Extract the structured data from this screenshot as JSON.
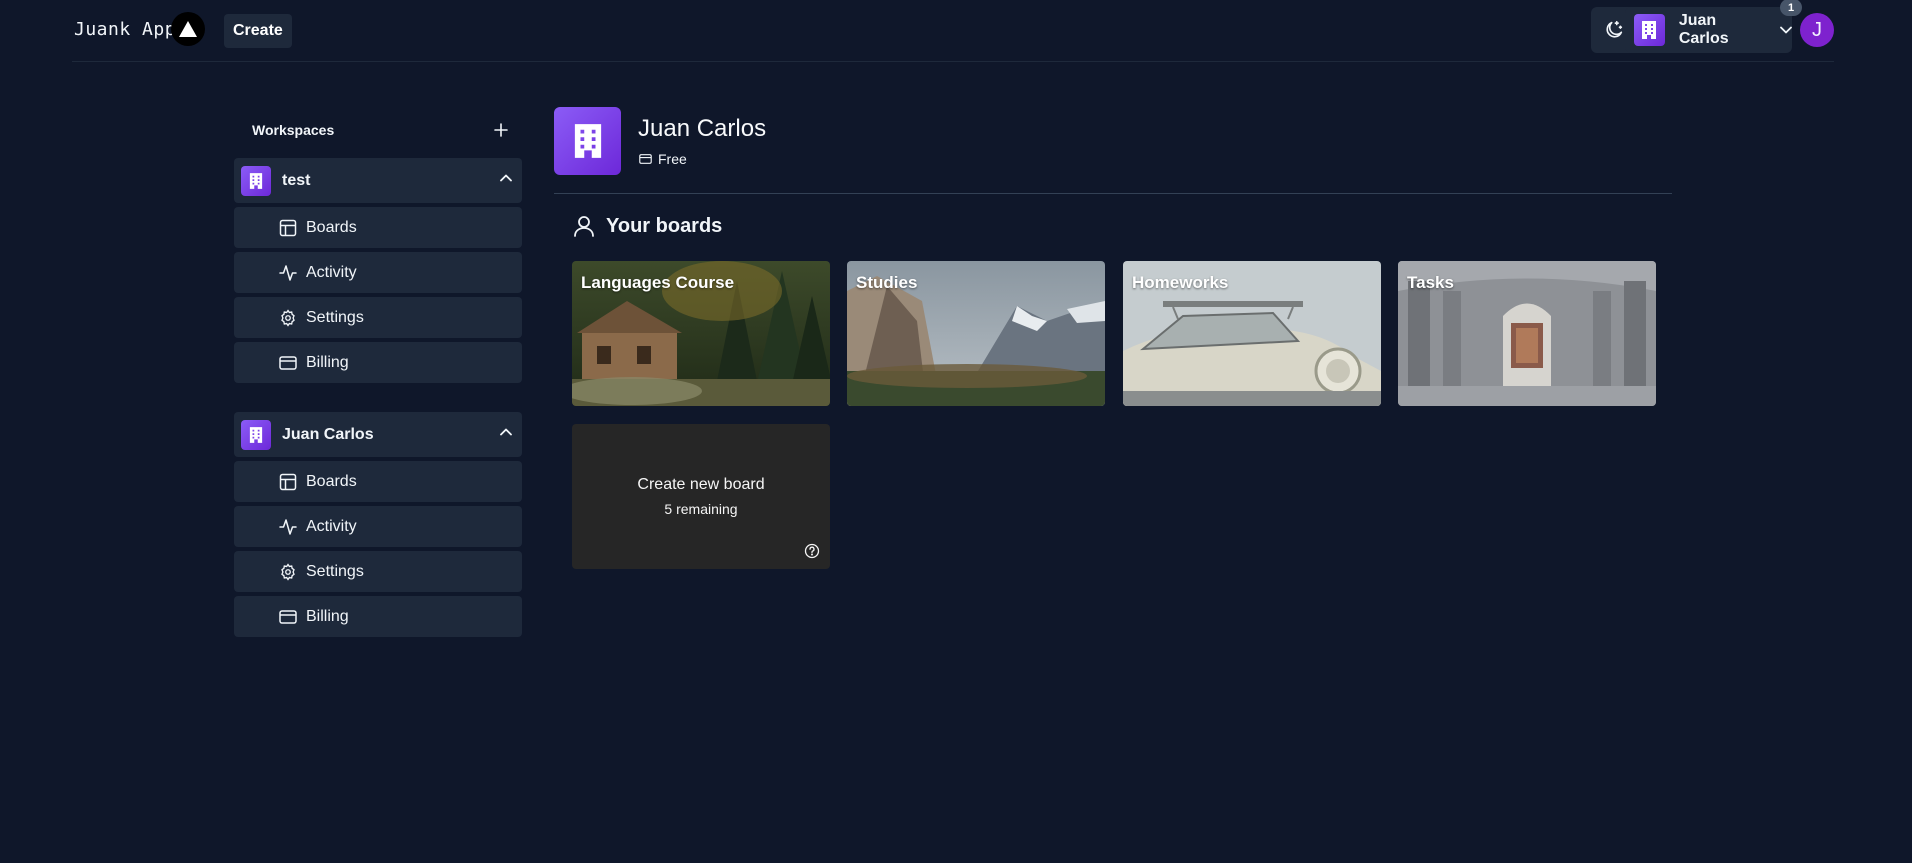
{
  "header": {
    "logo_text": "Juank App",
    "create_label": "Create",
    "workspace_name": "Juan Carlos",
    "notification_count": "1",
    "avatar_initial": "J"
  },
  "sidebar": {
    "title": "Workspaces",
    "workspaces": [
      {
        "name": "test",
        "items": [
          "Boards",
          "Activity",
          "Settings",
          "Billing"
        ]
      },
      {
        "name": "Juan Carlos",
        "items": [
          "Boards",
          "Activity",
          "Settings",
          "Billing"
        ]
      }
    ]
  },
  "main": {
    "workspace_title": "Juan Carlos",
    "plan": "Free",
    "boards_heading": "Your boards",
    "boards": [
      {
        "title": "Languages Course"
      },
      {
        "title": "Studies"
      },
      {
        "title": "Homeworks"
      },
      {
        "title": "Tasks"
      }
    ],
    "new_board": {
      "label": "Create new board",
      "remaining": "5 remaining"
    }
  },
  "colors": {
    "background": "#0f172a",
    "surface": "#1e293b",
    "accent": "#7c3aed",
    "avatar": "#7e22ce"
  }
}
